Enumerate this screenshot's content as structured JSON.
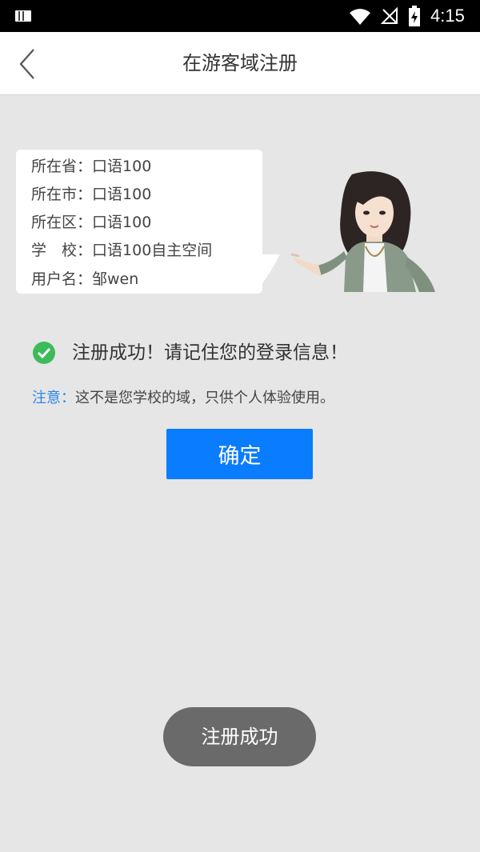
{
  "status_bar": {
    "time": "4:15",
    "icons": [
      "notification-icon",
      "wifi-icon",
      "no-signal-icon",
      "battery-icon"
    ]
  },
  "header": {
    "title": "在游客域注册",
    "back_icon": "chevron-left-icon"
  },
  "info": {
    "province_label": "所在省：",
    "province_value": "口语100",
    "city_label": "所在市：",
    "city_value": "口语100",
    "district_label": "所在区：",
    "district_value": "口语100",
    "school_label": "学　校：",
    "school_value": "口语100自主空间",
    "username_label": "用户名：",
    "username_value": "邹wen"
  },
  "success": {
    "icon": "check-circle-icon",
    "text": "注册成功！请记住您的登录信息！"
  },
  "note": {
    "label": "注意：",
    "text": "这不是您学校的域，只供个人体验使用。"
  },
  "confirm_button": {
    "label": "确定"
  },
  "toast": {
    "text": "注册成功"
  },
  "colors": {
    "accent": "#0a7cff",
    "success": "#3dbb5a",
    "note_label": "#2a86e8",
    "background": "#e6e6e6"
  }
}
